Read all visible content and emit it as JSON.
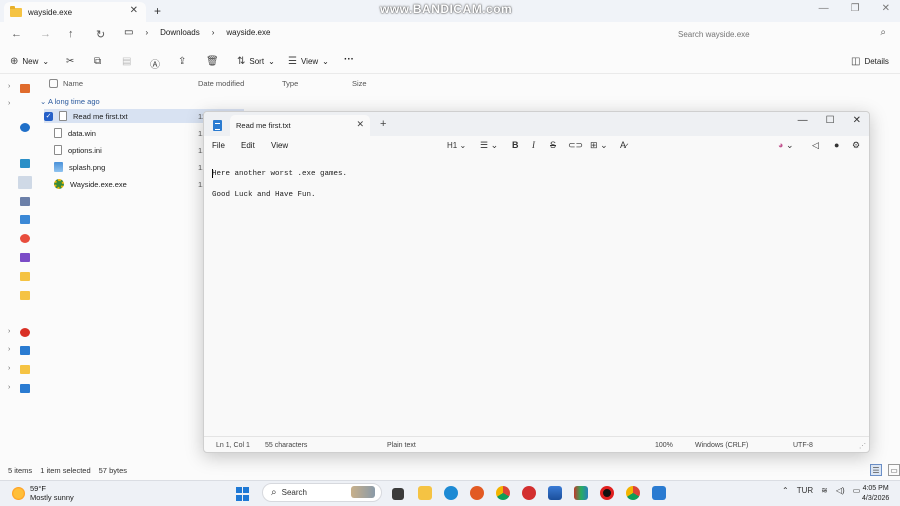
{
  "explorer": {
    "tab_title": "wayside.exe",
    "breadcrumb": [
      "Downloads",
      "wayside.exe"
    ],
    "search_placeholder": "Search wayside.exe",
    "toolbar": {
      "new_label": "New",
      "sort_label": "Sort",
      "view_label": "View",
      "more_label": "···",
      "details_label": "Details"
    },
    "columns": [
      "Name",
      "Date modified",
      "Type",
      "Size"
    ],
    "group_label": "A long time ago",
    "files": [
      {
        "name": "Read me first.txt",
        "date_trunc": "12",
        "icon": "text-file-icon",
        "selected": true
      },
      {
        "name": "data.win",
        "date_trunc": "1.",
        "icon": "file-icon",
        "selected": false
      },
      {
        "name": "options.ini",
        "date_trunc": "1.",
        "icon": "settings-file-icon",
        "selected": false
      },
      {
        "name": "splash.png",
        "date_trunc": "1.",
        "icon": "image-file-icon",
        "selected": false
      },
      {
        "name": "Wayside.exe.exe",
        "date_trunc": "1.",
        "icon": "exe-file-icon",
        "selected": false
      }
    ],
    "status": {
      "items": "5 items",
      "selected": "1 item selected",
      "size": "57 bytes"
    }
  },
  "watermark": "www.BANDICAM.com",
  "notepad": {
    "tab_title": "Read me first.txt",
    "menus": [
      "File",
      "Edit",
      "View"
    ],
    "heading_label": "H1",
    "content_lines": [
      "Here another worst .exe games.",
      "Good Luck and Have Fun."
    ],
    "status": {
      "position": "Ln 1, Col 1",
      "characters": "55 characters",
      "format": "Plain text",
      "zoom": "100%",
      "line_ending": "Windows (CRLF)",
      "encoding": "UTF-8"
    }
  },
  "taskbar": {
    "weather_temp": "59°F",
    "weather_desc": "Mostly sunny",
    "search_label": "Search",
    "language": "TUR",
    "time": "4:05 PM",
    "date": "4/3/2026"
  },
  "colors": {
    "accent": "#2560c8",
    "selection": "#d8e2f2",
    "taskbar_bg": "#eef1f6"
  }
}
